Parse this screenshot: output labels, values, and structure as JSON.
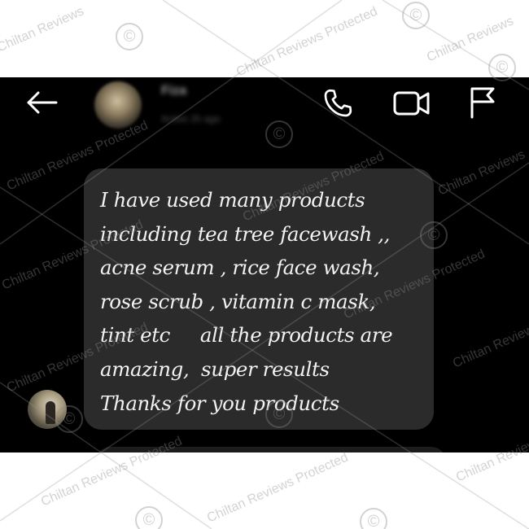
{
  "header": {
    "back_icon": "arrow-left-icon",
    "contact_name": "Fiza",
    "contact_status": "Active 2h ago",
    "call_icon": "phone-icon",
    "video_icon": "video-camera-icon",
    "report_icon": "flag-icon"
  },
  "message": {
    "lines": [
      "I have used many products",
      "including tea tree facewash ,,",
      "acne serum , rice face wash,",
      "rose scrub , vitamin c mask,",
      "tint etc     all the products are",
      "amazing,  super results",
      "Thanks for you products"
    ]
  },
  "watermark": {
    "text": "Chiltan Reviews Protected",
    "short_text": "Chiltan Reviews",
    "symbol": "©"
  },
  "colors": {
    "screen_background": "#000000",
    "bubble": "#2b2b2b",
    "text": "#f2f2f2",
    "icons": "#ffffff"
  }
}
